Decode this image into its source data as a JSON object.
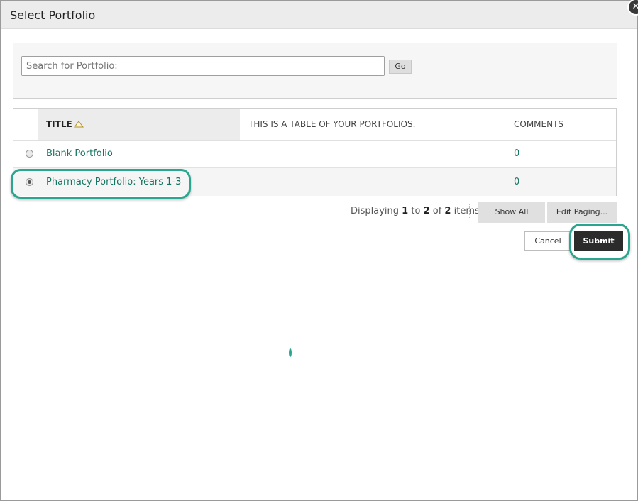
{
  "dialog": {
    "title": "Select Portfolio",
    "close_icon": "close-icon"
  },
  "search": {
    "placeholder": "Search for Portfolio:",
    "value": "",
    "go_label": "Go"
  },
  "table": {
    "columns": {
      "title": "TITLE",
      "description": "THIS IS A TABLE OF YOUR PORTFOLIOS.",
      "comments": "COMMENTS"
    },
    "sort_icon": "sort-ascending-icon",
    "rows": [
      {
        "title": "Blank Portfolio",
        "comments": "0",
        "selected": false
      },
      {
        "title": "Pharmacy Portfolio: Years 1-3",
        "comments": "0",
        "selected": true
      }
    ]
  },
  "paging": {
    "prefix": "Displaying",
    "from": "1",
    "to_word": "to",
    "to": "2",
    "of_word": "of",
    "total": "2",
    "suffix": "items",
    "show_all_label": "Show All",
    "edit_paging_label": "Edit Paging..."
  },
  "actions": {
    "cancel_label": "Cancel",
    "submit_label": "Submit"
  },
  "colors": {
    "accent": "#2aa590",
    "link": "#137461",
    "submit_bg": "#2b2b2b"
  }
}
